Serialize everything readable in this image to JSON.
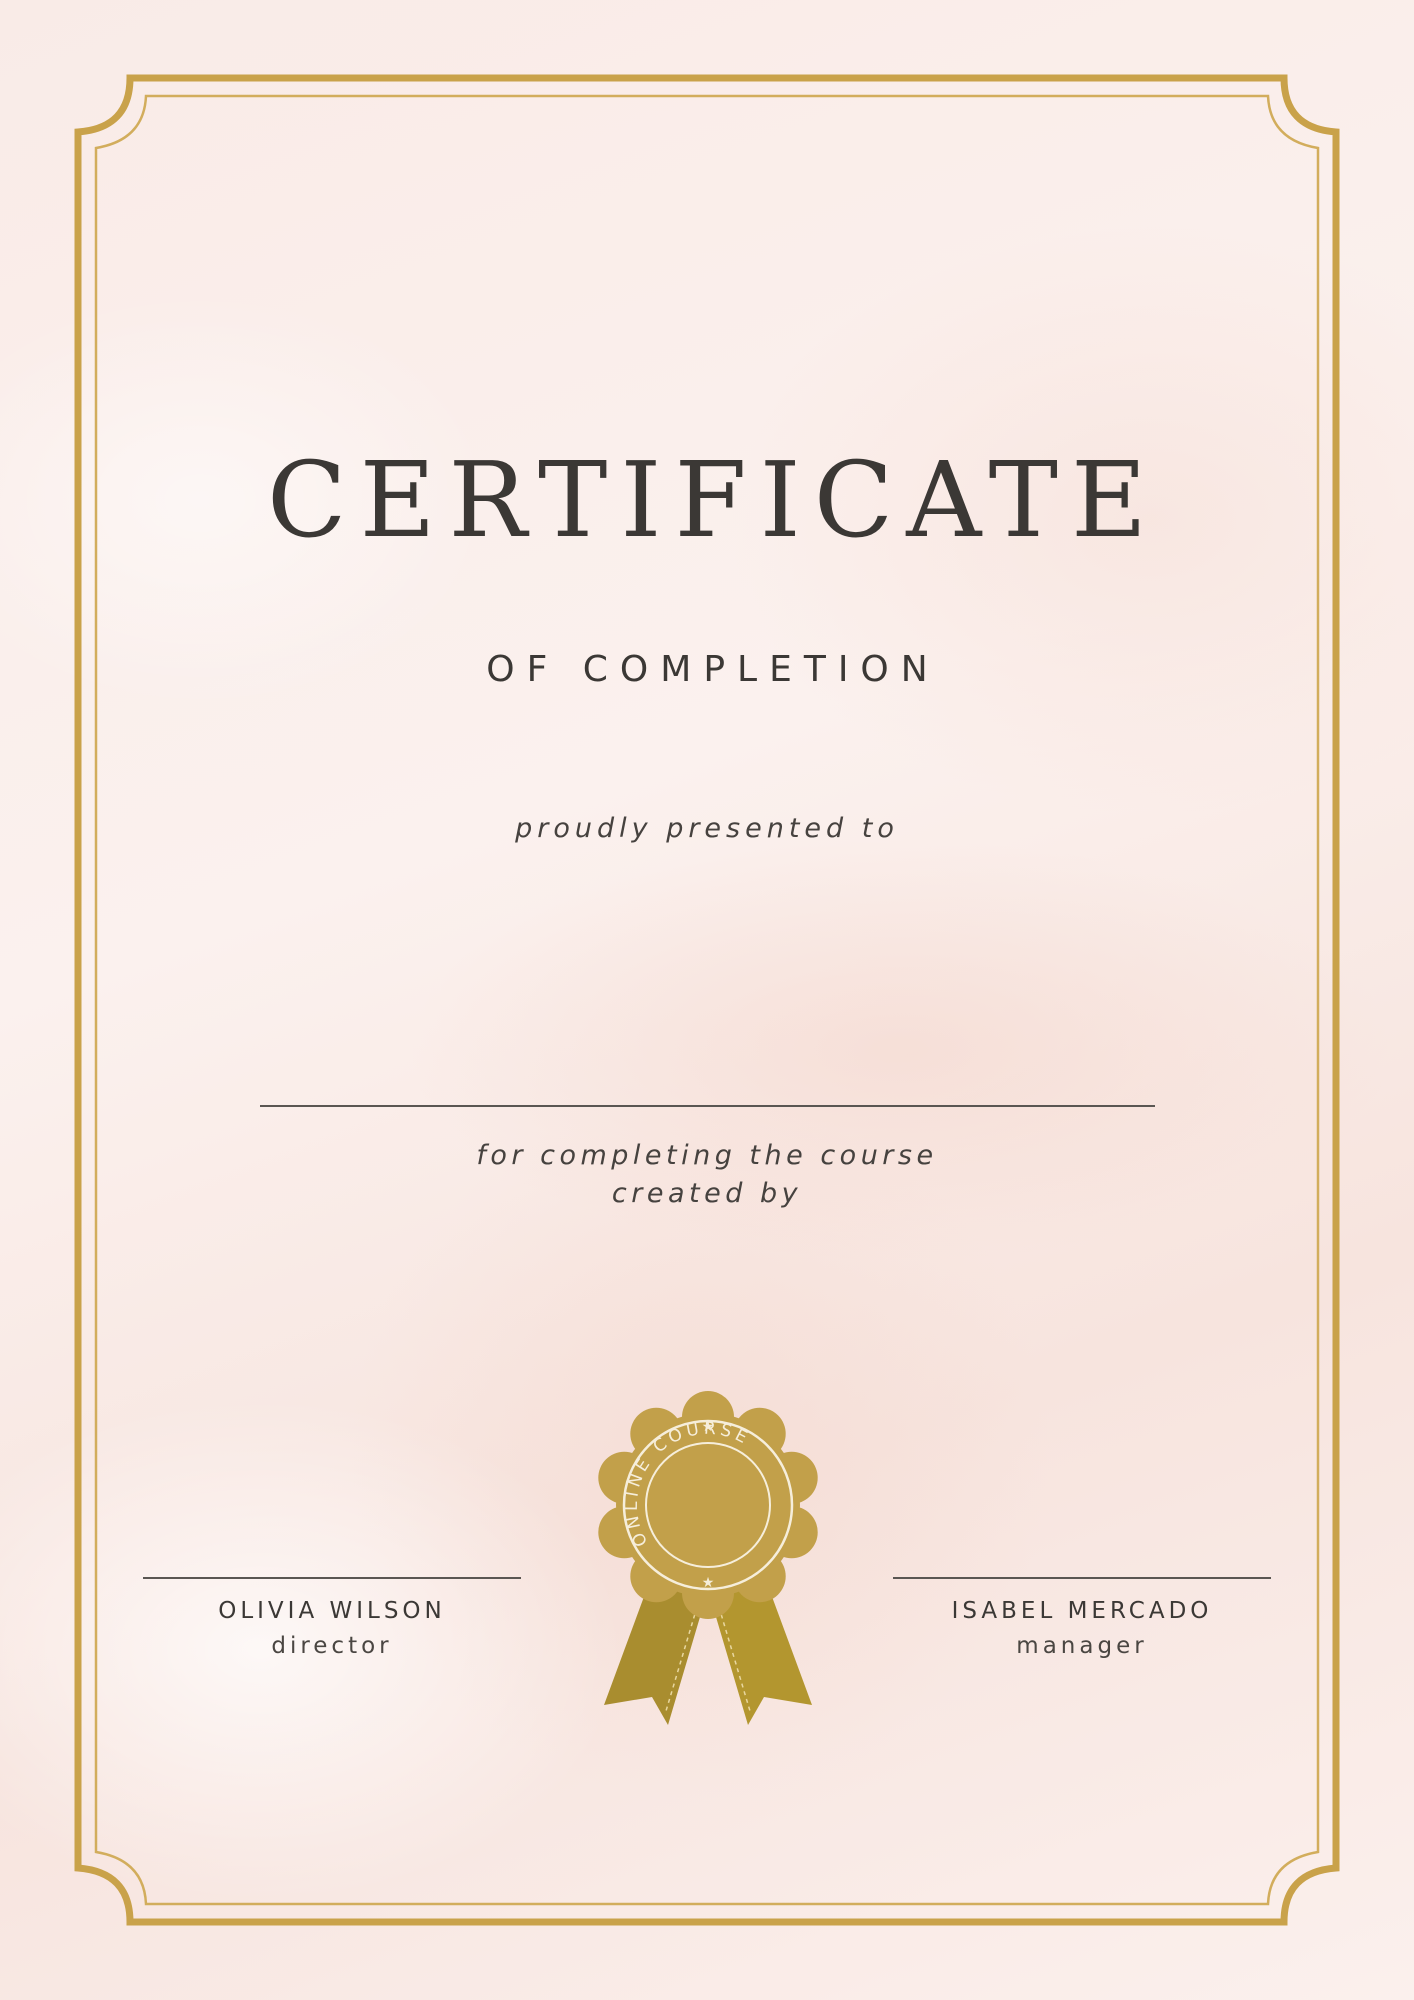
{
  "certificate": {
    "title": "CERTIFICATE",
    "subtitle": "OF COMPLETION",
    "presented_line": "proudly presented to",
    "course_line_1": "for completing the course",
    "course_line_2": "created by"
  },
  "seal": {
    "text": "ONLINE COURSE",
    "icon": "award-ribbon-seal-icon"
  },
  "signatures": [
    {
      "name": "OLIVIA WILSON",
      "role": "director"
    },
    {
      "name": "ISABEL MERCADO",
      "role": "manager"
    }
  ],
  "colors": {
    "border_gold": "#c9a24a",
    "seal_gold": "#c2a04a",
    "ribbon_gold": "#a98d2f",
    "text": "#3b3835",
    "background": "#fbefec"
  }
}
